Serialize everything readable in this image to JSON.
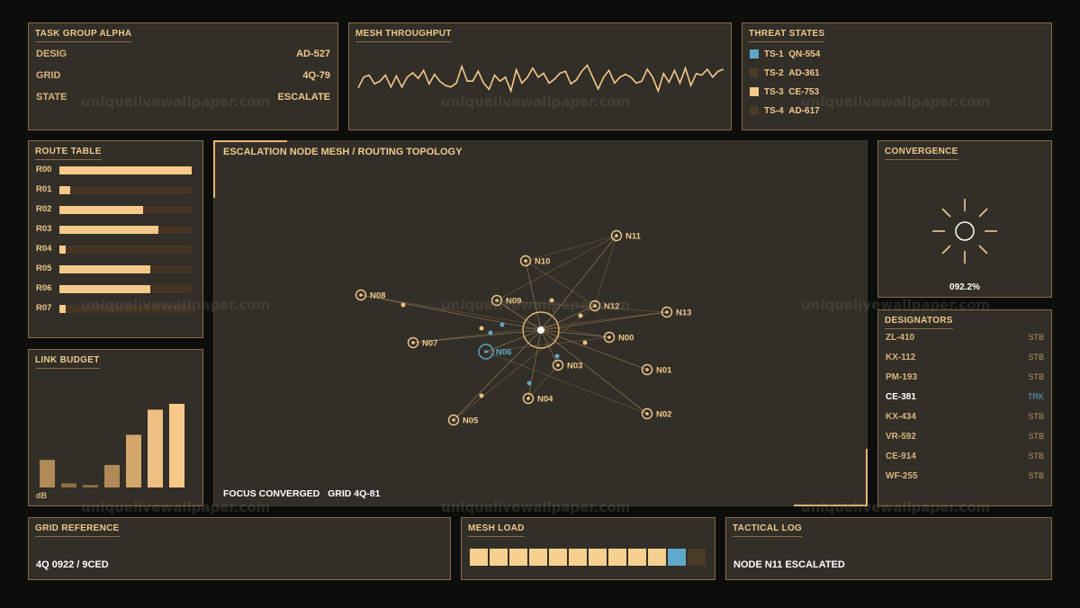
{
  "watermark": "uniquelivewallpaper.com",
  "task_group": {
    "title": "TASK GROUP ALPHA",
    "rows": [
      {
        "key": "DESIG",
        "value": "AD-527"
      },
      {
        "key": "GRID",
        "value": "4Q-79"
      },
      {
        "key": "STATE",
        "value": "ESCALATE"
      }
    ]
  },
  "mesh_throughput": {
    "title": "MESH THROUGHPUT",
    "series": [
      28,
      55,
      60,
      38,
      45,
      60,
      30,
      58,
      30,
      55,
      66,
      52,
      72,
      38,
      62,
      44,
      34,
      30,
      40,
      82,
      45,
      45,
      70,
      40,
      24,
      60,
      45,
      55,
      20,
      74,
      40,
      54,
      78,
      55,
      65,
      40,
      50,
      65,
      70,
      38,
      48,
      70,
      85,
      55,
      25,
      55,
      72,
      40,
      55,
      62,
      55,
      40,
      45,
      75,
      55,
      20,
      64,
      42,
      72,
      40,
      78,
      34,
      64,
      60,
      75,
      55,
      70,
      75
    ]
  },
  "threat_states": {
    "title": "THREAT STATES",
    "items": [
      {
        "code": "TS-1",
        "id": "QN-554",
        "color": "#5fa8c9"
      },
      {
        "code": "TS-2",
        "id": "AD-361",
        "color": "#4a3a28"
      },
      {
        "code": "TS-3",
        "id": "CE-753",
        "color": "#f5c98a"
      },
      {
        "code": "TS-4",
        "id": "AD-617",
        "color": "#4a3a28"
      }
    ]
  },
  "route_table": {
    "title": "ROUTE TABLE",
    "rows": [
      {
        "label": "R00",
        "value": 1.0
      },
      {
        "label": "R01",
        "value": 0.08
      },
      {
        "label": "R02",
        "value": 0.63
      },
      {
        "label": "R03",
        "value": 0.75
      },
      {
        "label": "R04",
        "value": 0.05
      },
      {
        "label": "R05",
        "value": 0.69
      },
      {
        "label": "R06",
        "value": 0.69
      },
      {
        "label": "R07",
        "value": 0.05
      }
    ]
  },
  "link_budget": {
    "title": "LINK BUDGET",
    "unit": "dB",
    "values": [
      0.33,
      0.05,
      0.03,
      0.27,
      0.63,
      0.93,
      1.0
    ]
  },
  "topology": {
    "title": "ESCALATION NODE MESH / ROUTING TOPOLOGY",
    "focus_label": "FOCUS CONVERGED",
    "grid_label": "GRID 4Q-81",
    "nodes": [
      {
        "id": "N00",
        "state": "normal"
      },
      {
        "id": "N01",
        "state": "normal"
      },
      {
        "id": "N02",
        "state": "normal"
      },
      {
        "id": "N03",
        "state": "normal"
      },
      {
        "id": "N04",
        "state": "normal"
      },
      {
        "id": "N05",
        "state": "normal"
      },
      {
        "id": "N06",
        "state": "focus"
      },
      {
        "id": "N07",
        "state": "normal"
      },
      {
        "id": "N08",
        "state": "normal"
      },
      {
        "id": "N09",
        "state": "normal"
      },
      {
        "id": "N10",
        "state": "normal"
      },
      {
        "id": "N11",
        "state": "normal"
      },
      {
        "id": "N12",
        "state": "normal"
      },
      {
        "id": "N13",
        "state": "normal"
      }
    ]
  },
  "convergence": {
    "title": "CONVERGENCE",
    "value": "092.2%"
  },
  "designators": {
    "title": "DESIGNATORS",
    "items": [
      {
        "code": "ZL-410",
        "status": "STB",
        "active": false
      },
      {
        "code": "KX-112",
        "status": "STB",
        "active": false
      },
      {
        "code": "PM-193",
        "status": "STB",
        "active": false
      },
      {
        "code": "CE-381",
        "status": "TRK",
        "active": true
      },
      {
        "code": "KX-434",
        "status": "STB",
        "active": false
      },
      {
        "code": "VR-592",
        "status": "STB",
        "active": false
      },
      {
        "code": "CE-914",
        "status": "STB",
        "active": false
      },
      {
        "code": "WF-255",
        "status": "STB",
        "active": false
      }
    ]
  },
  "grid_reference": {
    "title": "GRID REFERENCE",
    "value": "4Q 0922 / 9CED"
  },
  "mesh_load": {
    "title": "MESH LOAD",
    "cells": [
      "on",
      "on",
      "on",
      "on",
      "on",
      "on",
      "on",
      "on",
      "on",
      "on",
      "alert",
      "off"
    ],
    "colors": {
      "on": "#f5d08e",
      "alert": "#5fa8c9",
      "off": "#4a3a28"
    }
  },
  "tactical_log": {
    "title": "TACTICAL LOG",
    "entry": "NODE N11 ESCALATED"
  },
  "colors": {
    "accent": "#f5c98a",
    "accent_blue": "#5fa8c9",
    "panel_bg": "#322e28",
    "border": "#8a6c45"
  }
}
